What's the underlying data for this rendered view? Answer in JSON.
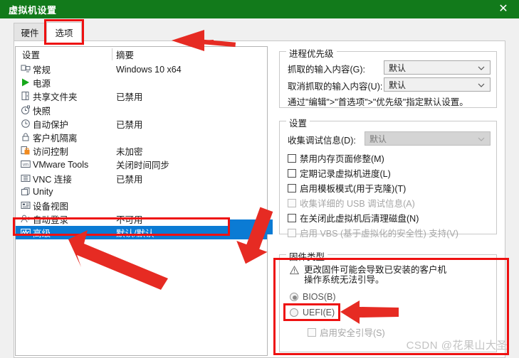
{
  "window": {
    "title": "虚拟机设置",
    "close_label": "✕",
    "titlebar_color": "#127a1b"
  },
  "tabs": [
    {
      "label": "硬件",
      "active": false
    },
    {
      "label": "选项",
      "active": true
    }
  ],
  "list": {
    "headers": {
      "settings": "设置",
      "summary": "摘要"
    },
    "rows": [
      {
        "icon": "monitor-icon",
        "name": "常规",
        "summary": "Windows 10 x64",
        "selected": false
      },
      {
        "icon": "power-play-icon",
        "name": "电源",
        "summary": "",
        "selected": false
      },
      {
        "icon": "shared-folder-icon",
        "name": "共享文件夹",
        "summary": "已禁用",
        "selected": false
      },
      {
        "icon": "snapshot-icon",
        "name": "快照",
        "summary": "",
        "selected": false
      },
      {
        "icon": "autoprotect-icon",
        "name": "自动保护",
        "summary": "已禁用",
        "selected": false
      },
      {
        "icon": "lock-icon",
        "name": "客户机隔离",
        "summary": "",
        "selected": false
      },
      {
        "icon": "access-lock-icon",
        "name": "访问控制",
        "summary": "未加密",
        "selected": false
      },
      {
        "icon": "vmware-tools-icon",
        "name": "VMware Tools",
        "summary": "关闭时间同步",
        "selected": false
      },
      {
        "icon": "vnc-icon",
        "name": "VNC 连接",
        "summary": "已禁用",
        "selected": false
      },
      {
        "icon": "unity-icon",
        "name": "Unity",
        "summary": "",
        "selected": false
      },
      {
        "icon": "device-view-icon",
        "name": "设备视图",
        "summary": "",
        "selected": false
      },
      {
        "icon": "autologon-icon",
        "name": "自动登录",
        "summary": "不可用",
        "selected": false
      },
      {
        "icon": "advanced-icon",
        "name": "高级",
        "summary": "默认/默认",
        "selected": true
      }
    ]
  },
  "priority_group": {
    "title": "进程优先级",
    "grab_label": "抓取的输入内容(G):",
    "grab_value": "默认",
    "ungrab_label": "取消抓取的输入内容(U):",
    "ungrab_value": "默认",
    "note": "通过\"编辑\">\"首选项\">\"优先级\"指定默认设置。"
  },
  "settings_group": {
    "title": "设置",
    "debug_label": "收集调试信息(D):",
    "debug_value": "默认",
    "debug_disabled": true,
    "checkboxes": [
      {
        "label": "禁用内存页面修整(M)",
        "checked": false,
        "disabled": false
      },
      {
        "label": "定期记录虚拟机进度(L)",
        "checked": false,
        "disabled": false
      },
      {
        "label": "启用模板模式(用于克隆)(T)",
        "checked": false,
        "disabled": false
      },
      {
        "label": "收集详细的 USB 调试信息(A)",
        "checked": false,
        "disabled": true
      },
      {
        "label": "在关闭此虚拟机后清理磁盘(N)",
        "checked": false,
        "disabled": false
      },
      {
        "label": "启用 VBS (基于虚拟化的安全性) 支持(V)",
        "checked": false,
        "disabled": true
      }
    ]
  },
  "firmware_group": {
    "title": "固件类型",
    "warning_line1": "更改固件可能会导致已安装的客户机",
    "warning_line2": "操作系统无法引导。",
    "radios": [
      {
        "label": "BIOS(B)",
        "checked": true
      },
      {
        "label": "UEFI(E)",
        "checked": false
      }
    ],
    "secure_boot": {
      "label": "启用安全引导(S)",
      "checked": false,
      "disabled": true
    }
  },
  "annotations": {
    "color": "#ee1111",
    "rect_tab": "highlight-options-tab",
    "rect_advanced_row": "highlight-advanced-row",
    "rect_firmware": "highlight-firmware-group",
    "rect_bios": "highlight-bios-radio"
  },
  "watermark": "CSDN @花果山大圣"
}
